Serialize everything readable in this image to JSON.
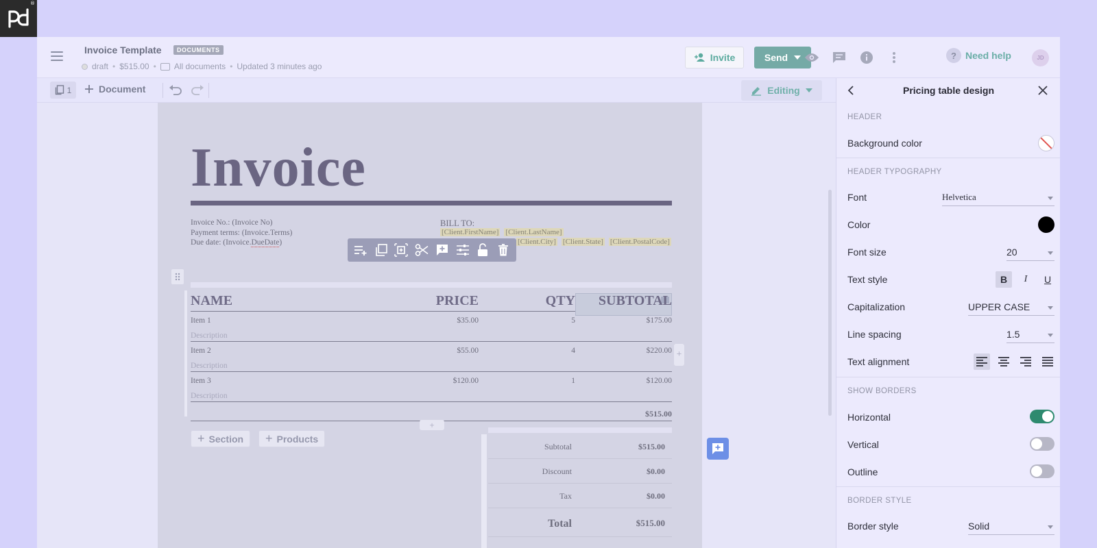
{
  "logo": {
    "text": "pd",
    "registered": "®"
  },
  "header": {
    "menu_icon": "hamburger-icon",
    "title": "Invoice Template",
    "badge": "DOCUMENTS",
    "status": "draft",
    "amount": "$515.00",
    "folder": "All documents",
    "updated": "Updated 3 minutes ago",
    "invite_label": "Invite",
    "send_label": "Send",
    "help_label": "Need help",
    "avatar_initials": "JD",
    "icons": [
      "eye-icon",
      "chat-icon",
      "info-icon",
      "more-vertical-icon"
    ]
  },
  "toolbar": {
    "pages_count": "1",
    "add_document_label": "Document",
    "mode_label": "Editing"
  },
  "document": {
    "title": "Invoice",
    "invoice_no": "Invoice No.: (Invoice No)",
    "payment_terms": "Payment terms: (Invoice.Terms)",
    "due_date_prefix": "Due date: (Invoice.",
    "due_date_word": "DueDate",
    "due_date_suffix": ")",
    "bill_to": "BILL TO:",
    "tokens_row1": [
      "[Client.FirstName]",
      "[Client.LastName]"
    ],
    "tokens_row2": [
      "[Client.City]",
      "[Client.State]",
      "[Client.PostalCode]"
    ]
  },
  "pricing_table": {
    "headers": {
      "name": "NAME",
      "price": "PRICE",
      "qty": "QTY",
      "subtotal": "SUBTOTAL"
    },
    "rows": [
      {
        "name": "Item 1",
        "description": "Description",
        "price": "$35.00",
        "qty": "5",
        "subtotal": "$175.00"
      },
      {
        "name": "Item 2",
        "description": "Description",
        "price": "$55.00",
        "qty": "4",
        "subtotal": "$220.00"
      },
      {
        "name": "Item 3",
        "description": "Description",
        "price": "$120.00",
        "qty": "1",
        "subtotal": "$120.00"
      }
    ],
    "total": "$515.00"
  },
  "add_buttons": {
    "section": "Section",
    "products": "Products",
    "add_symbol": "+"
  },
  "summary": [
    {
      "label": "Subtotal",
      "value": "$515.00"
    },
    {
      "label": "Discount",
      "value": "$0.00"
    },
    {
      "label": "Tax",
      "value": "$0.00"
    },
    {
      "label": "Total",
      "value": "$515.00"
    }
  ],
  "panel": {
    "title": "Pricing table design",
    "sections": {
      "header": "HEADER",
      "header_typography": "HEADER TYPOGRAPHY",
      "show_borders": "SHOW BORDERS",
      "border_style": "BORDER STYLE"
    },
    "background_color_label": "Background color",
    "font_label": "Font",
    "font_value": "Helvetica",
    "color_label": "Color",
    "color_value": "#000000",
    "font_size_label": "Font size",
    "font_size_value": "20",
    "text_style_label": "Text style",
    "text_style_buttons": [
      "B",
      "I",
      "U"
    ],
    "capitalization_label": "Capitalization",
    "capitalization_value": "UPPER CASE",
    "line_spacing_label": "Line spacing",
    "line_spacing_value": "1.5",
    "text_alignment_label": "Text alignment",
    "borders": [
      {
        "label": "Horizontal",
        "on": true
      },
      {
        "label": "Vertical",
        "on": false
      },
      {
        "label": "Outline",
        "on": false
      }
    ],
    "border_style_label": "Border style",
    "border_style_value": "Solid"
  },
  "colors": {
    "accent_teal": "#5cab9f",
    "send_bg": "#75aaa6",
    "toggle_on": "#2e8a6f",
    "background": "#d5d2fb"
  }
}
